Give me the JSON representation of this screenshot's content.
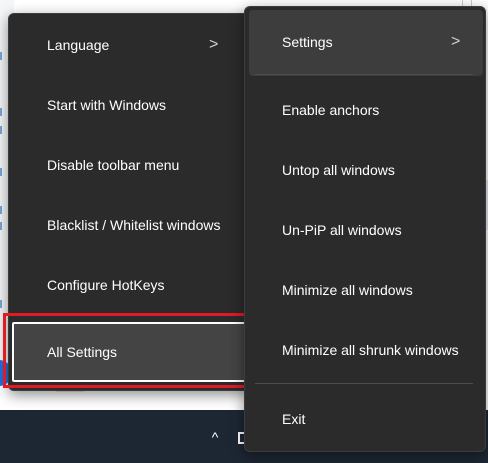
{
  "left_menu": {
    "items": [
      {
        "label": "Language",
        "has_submenu": true
      },
      {
        "label": "Start with Windows"
      },
      {
        "label": "Disable toolbar menu"
      },
      {
        "label": "Blacklist / Whitelist windows"
      },
      {
        "label": "Configure HotKeys"
      },
      {
        "label": "All Settings",
        "selected": true
      }
    ],
    "chevron": ">"
  },
  "right_menu": {
    "items": [
      {
        "label": "Settings",
        "has_submenu": true,
        "hovered": true
      },
      {
        "label": "Enable anchors"
      },
      {
        "label": "Untop all windows"
      },
      {
        "label": "Un-PiP all windows"
      },
      {
        "label": "Minimize all windows"
      },
      {
        "label": "Minimize all shrunk windows"
      },
      {
        "label": "Exit"
      }
    ],
    "chevron": ">"
  },
  "taskbar": {
    "tray_chevron": "^"
  },
  "annotation": {
    "highlight_color": "#e01b24"
  },
  "colors": {
    "menu_bg": "#2b2b2b",
    "taskbar": "#1d2733"
  }
}
